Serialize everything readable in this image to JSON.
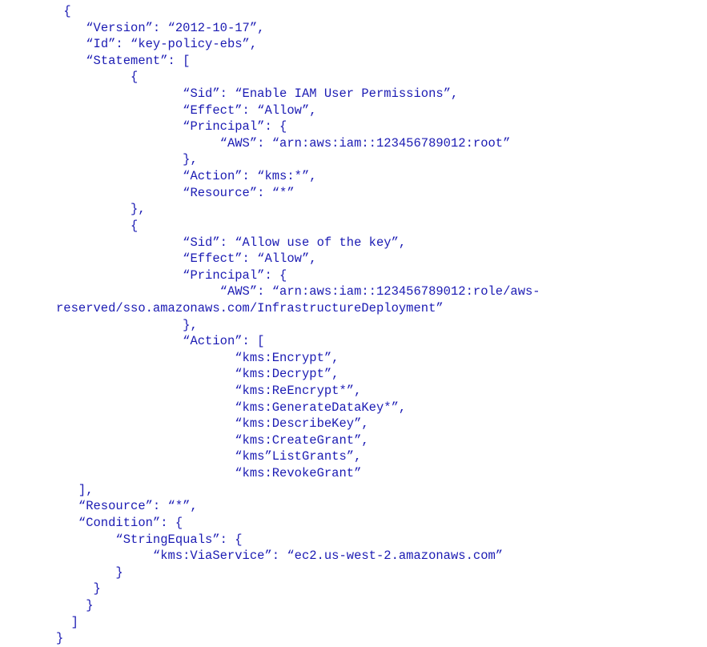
{
  "code_lines": [
    " {",
    "    “Version”: “2012-10-17”,",
    "    “Id”: “key-policy-ebs”,",
    "    “Statement”: [",
    "          {",
    "                 “Sid”: “Enable IAM User Permissions”,",
    "                 “Effect”: “Allow”,",
    "                 “Principal”: {",
    "                      “AWS”: “arn:aws:iam::123456789012:root”",
    "                 },",
    "                 “Action”: “kms:*”,",
    "                 “Resource”: “*”",
    "          },",
    "          {",
    "                 “Sid”: “Allow use of the key”,",
    "                 “Effect”: “Allow”,",
    "                 “Principal”: {",
    "                      “AWS”: “arn:aws:iam::123456789012:role/aws-reserved/sso.amazonaws.com/InfrastructureDeployment”",
    "                 },",
    "                 “Action”: [",
    "                        “kms:Encrypt”,",
    "                        “kms:Decrypt”,",
    "                        “kms:ReEncrypt*”,",
    "                        “kms:GenerateDataKey*”,",
    "                        “kms:DescribeKey”,",
    "                        “kms:CreateGrant”,",
    "                        “kms”ListGrants”,",
    "                        “kms:RevokeGrant”",
    "   ],",
    "   “Resource”: “*”,",
    "   “Condition”: {",
    "        “StringEquals”: {",
    "             “kms:ViaService”: “ec2.us-west-2.amazonaws.com”",
    "        }",
    "     }",
    "    }",
    "  ]",
    "}"
  ],
  "policy": {
    "Version": "2012-10-17",
    "Id": "key-policy-ebs",
    "Statement": [
      {
        "Sid": "Enable IAM User Permissions",
        "Effect": "Allow",
        "Principal": {
          "AWS": "arn:aws:iam::123456789012:root"
        },
        "Action": "kms:*",
        "Resource": "*"
      },
      {
        "Sid": "Allow use of the key",
        "Effect": "Allow",
        "Principal": {
          "AWS": "arn:aws:iam::123456789012:role/aws-reserved/sso.amazonaws.com/InfrastructureDeployment"
        },
        "Action": [
          "kms:Encrypt",
          "kms:Decrypt",
          "kms:ReEncrypt*",
          "kms:GenerateDataKey*",
          "kms:DescribeKey",
          "kms:CreateGrant",
          "kms”ListGrants",
          "kms:RevokeGrant"
        ],
        "Resource": "*",
        "Condition": {
          "StringEquals": {
            "kms:ViaService": "ec2.us-west-2.amazonaws.com"
          }
        }
      }
    ]
  }
}
